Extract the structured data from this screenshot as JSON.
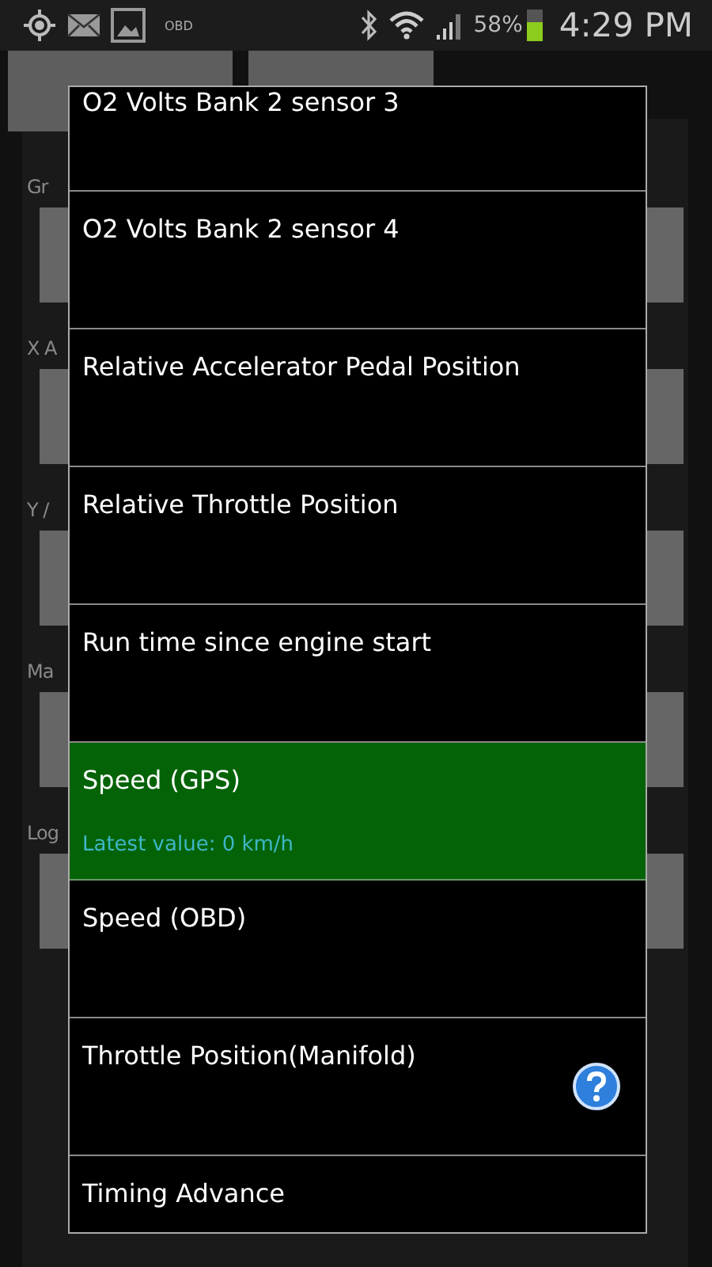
{
  "status_bar": {
    "notifications": [
      {
        "kind": "location"
      },
      {
        "kind": "mail"
      },
      {
        "kind": "picture"
      },
      {
        "kind": "text",
        "label": "OBD"
      }
    ],
    "battery_percent": "58%",
    "battery": {
      "level": 0.58
    },
    "time": "4:29 PM"
  },
  "background": {
    "labels": [
      "Gr",
      "X A",
      "Y /",
      "Ma",
      "Log"
    ]
  },
  "dialog": {
    "items": [
      {
        "label": "O2 Volts Bank 2 sensor 3",
        "selected": false,
        "help": false
      },
      {
        "label": "O2 Volts Bank 2 sensor 4",
        "selected": false,
        "help": false
      },
      {
        "label": "Relative Accelerator Pedal Position",
        "selected": false,
        "help": false
      },
      {
        "label": "Relative Throttle Position",
        "selected": false,
        "help": false
      },
      {
        "label": "Run time since engine start",
        "selected": false,
        "help": false
      },
      {
        "label": "Speed (GPS)",
        "selected": true,
        "help": false,
        "subtitle": "Latest value: 0 km/h"
      },
      {
        "label": "Speed (OBD)",
        "selected": false,
        "help": false
      },
      {
        "label": "Throttle Position(Manifold)",
        "selected": false,
        "help": true
      },
      {
        "label": "Timing Advance",
        "selected": false,
        "help": false
      }
    ]
  }
}
